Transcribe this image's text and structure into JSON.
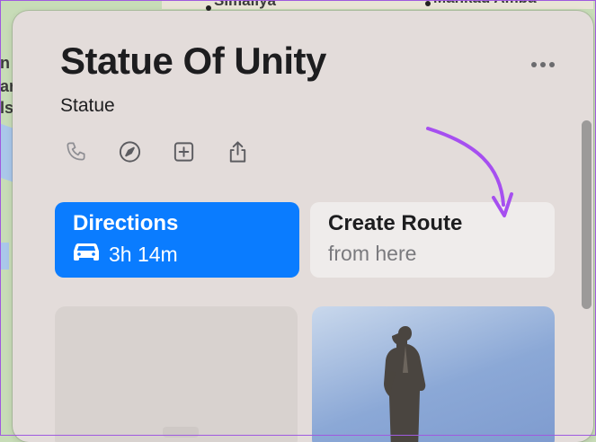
{
  "map": {
    "labels": {
      "top_center": "Simaliya",
      "top_right": "Mankad Amba",
      "left_1": "n",
      "left_2": "ar",
      "left_3": "ls"
    }
  },
  "place": {
    "title": "Statue Of Unity",
    "category": "Statue"
  },
  "actions": [
    {
      "icon": "phone-icon"
    },
    {
      "icon": "compass-icon"
    },
    {
      "icon": "add-icon"
    },
    {
      "icon": "share-icon"
    }
  ],
  "directions": {
    "label": "Directions",
    "eta": "3h 14m",
    "icon": "car-icon"
  },
  "create_route": {
    "label": "Create Route",
    "sublabel": "from here"
  },
  "colors": {
    "accent": "#0a7cff",
    "annotation": "#a64ff0",
    "panel": "#e3dcda"
  }
}
